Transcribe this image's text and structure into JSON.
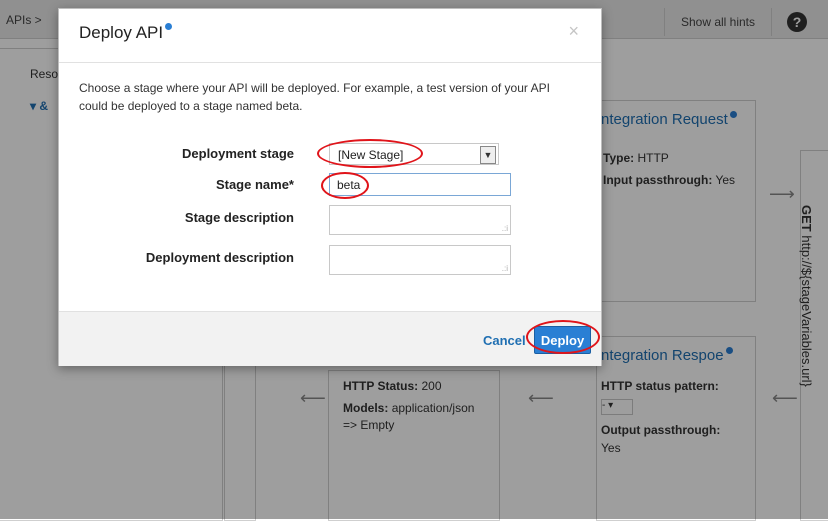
{
  "topbar": {
    "breadcrumb": "APIs >",
    "hints_label": "Show all hints",
    "help_glyph": "?"
  },
  "left_panel": {
    "resources_label": "Reso",
    "tree_marker": "▾ &"
  },
  "integration_request": {
    "title": "ntegration Request",
    "type_label": "Type:",
    "type_value": "HTTP",
    "passthrough_label": "Input passthrough:",
    "passthrough_value": "Yes"
  },
  "method_response": {
    "status_label": "HTTP Status:",
    "status_value": "200",
    "models_label": "Models:",
    "models_value": "application/json",
    "models_value2": "=> Empty"
  },
  "integration_response": {
    "title": "ntegration Respo",
    "title_tail": "e",
    "pattern_label": "HTTP status pattern:",
    "pattern_value": "- ▾",
    "output_label": "Output passthrough:",
    "output_value": "Yes"
  },
  "endpoint": {
    "method": "GET",
    "url": "http://${stageVariables.url}"
  },
  "arrows": {
    "right": "⟶",
    "left": "⟵"
  },
  "modal": {
    "title": "Deploy API",
    "close": "×",
    "intro": "Choose a stage where your API will be deployed. For example, a test version of your API could be deployed to a stage named beta.",
    "labels": {
      "stage": "Deployment stage",
      "name": "Stage name*",
      "stage_desc": "Stage description",
      "deploy_desc": "Deployment description"
    },
    "stage_value": "[New Stage]",
    "name_value": "beta",
    "cancel": "Cancel",
    "deploy": "Deploy"
  },
  "colors": {
    "accent": "#2a7fd4",
    "annotation": "#e0141a",
    "link": "#1f6fb2"
  }
}
